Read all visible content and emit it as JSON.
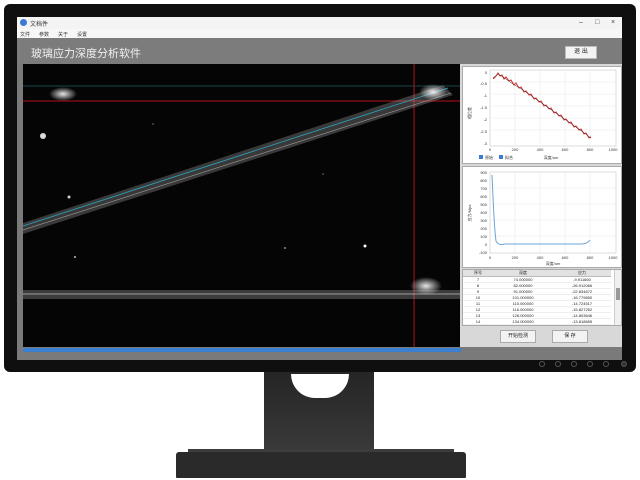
{
  "window": {
    "title": "文档件"
  },
  "menu": [
    "文件",
    "参数",
    "关于",
    "设置"
  ],
  "header": {
    "title": "玻璃应力深度分析软件",
    "exit_label": "退 出"
  },
  "top_chart": {
    "y_ticks": [
      "0",
      "-0.5",
      "-1",
      "-1.5",
      "-2",
      "-2.5",
      "-3"
    ],
    "x_ticks": [
      "0",
      "200",
      "400",
      "600",
      "800",
      "1000"
    ],
    "ylabel": "相位差",
    "xlabel": "深度/um",
    "legend": [
      "原始",
      "拟合"
    ],
    "colors": {
      "raw": "#d62828",
      "fit": "#2b2b2b"
    }
  },
  "bottom_chart": {
    "y_ticks": [
      "900",
      "800",
      "700",
      "600",
      "500",
      "400",
      "300",
      "200",
      "100",
      "0",
      "-100"
    ],
    "x_ticks": [
      "0",
      "200",
      "400",
      "600",
      "800",
      "1000"
    ],
    "ylabel": "应力/Mpa",
    "xlabel": "深度/um",
    "color": "#6aa4d8"
  },
  "table": {
    "headers": [
      "序号",
      "深度",
      "应力"
    ],
    "rows": [
      [
        "7",
        "74.000000",
        "-9.911660"
      ],
      [
        "8",
        "82.000000",
        "-26.912066"
      ],
      [
        "9",
        "91.000000",
        "-22.834672"
      ],
      [
        "10",
        "101.000000",
        "-16.779650"
      ],
      [
        "11",
        "110.000000",
        "-14.724517"
      ],
      [
        "12",
        "116.000000",
        "-15.827252"
      ],
      [
        "13",
        "126.000000",
        "-14.803646"
      ],
      [
        "14",
        "134.000000",
        "-13.818655"
      ]
    ]
  },
  "buttons": {
    "start": "开始检测",
    "save": "保 存"
  },
  "progress": 1.0
}
